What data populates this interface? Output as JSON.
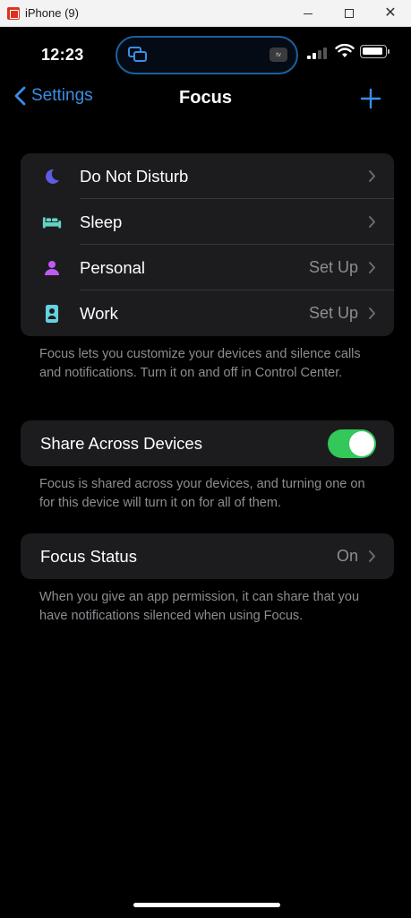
{
  "window": {
    "title": "iPhone (9)",
    "close_glyph": "✕"
  },
  "status_bar": {
    "time": "12:23",
    "island_badge": "tv"
  },
  "nav": {
    "back_label": "Settings",
    "title": "Focus",
    "add_icon": "plus-icon"
  },
  "focus_modes": [
    {
      "label": "Do Not Disturb",
      "value": "",
      "icon": "moon-icon",
      "color": "#5e5ce6"
    },
    {
      "label": "Sleep",
      "value": "",
      "icon": "bed-icon",
      "color": "#64d2c4"
    },
    {
      "label": "Personal",
      "value": "Set Up",
      "icon": "person-icon",
      "color": "#bf5af2"
    },
    {
      "label": "Work",
      "value": "Set Up",
      "icon": "badge-icon",
      "color": "#64d2e0"
    }
  ],
  "focus_footer": "Focus lets you customize your devices and silence calls and notifications. Turn it on and off in Control Center.",
  "share": {
    "label": "Share Across Devices",
    "enabled": true,
    "footer": "Focus is shared across your devices, and turning one on for this device will turn it on for all of them."
  },
  "status": {
    "label": "Focus Status",
    "value": "On",
    "footer": "When you give an app permission, it can share that you have notifications silenced when using Focus."
  },
  "colors": {
    "accent": "#3a8ee6",
    "toggle_on": "#34c759",
    "group_bg": "#1c1c1e",
    "secondary_text": "#8d8d93"
  }
}
